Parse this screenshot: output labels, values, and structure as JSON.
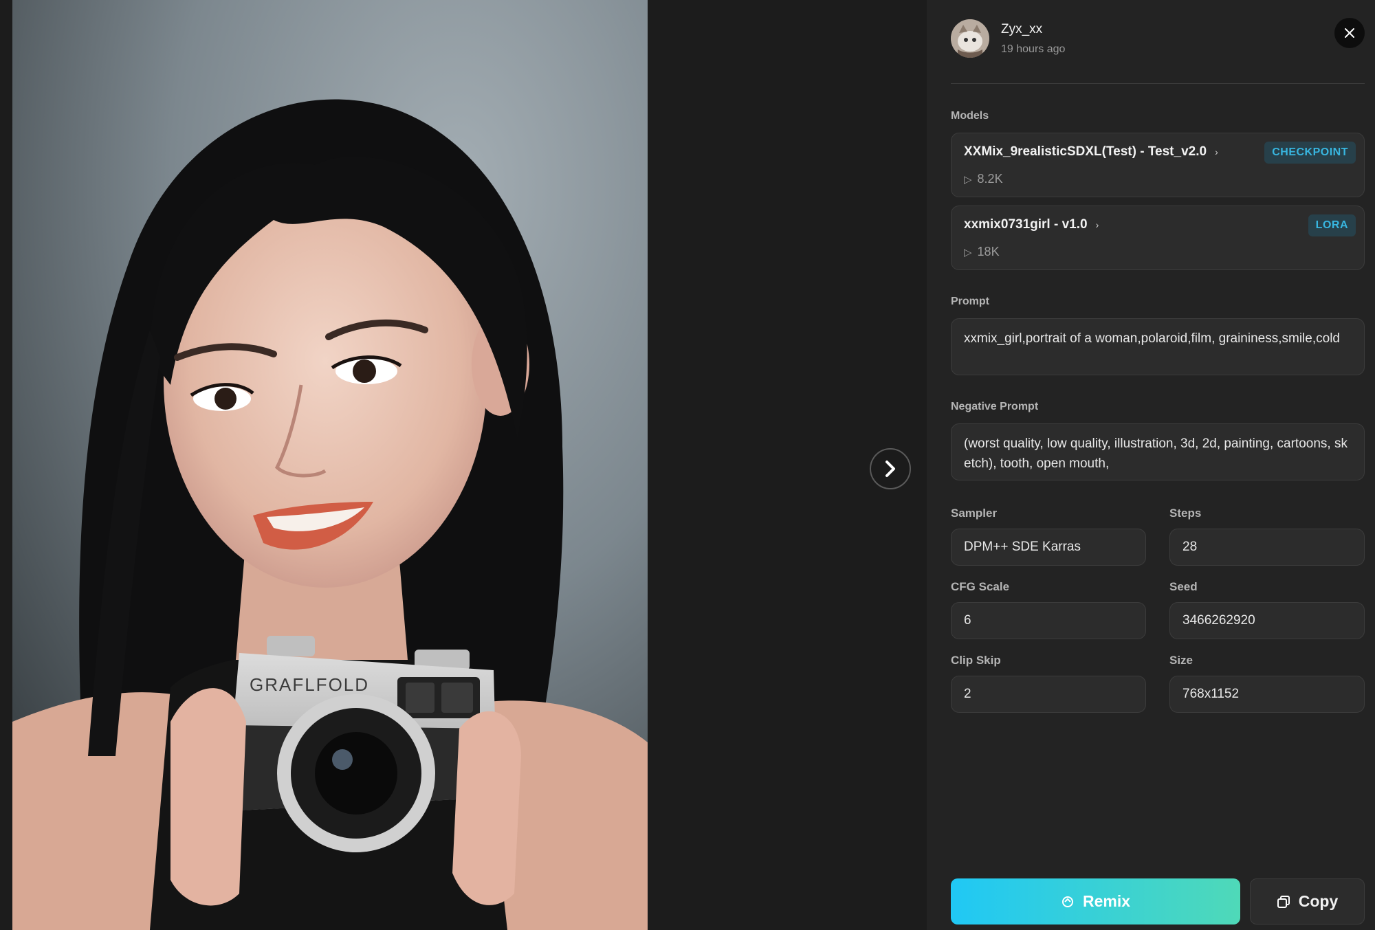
{
  "author": {
    "name": "Zyx_xx",
    "time": "19 hours ago"
  },
  "sections": {
    "models": "Models",
    "prompt": "Prompt",
    "negative_prompt": "Negative Prompt"
  },
  "models": [
    {
      "title": "XXMix_9realisticSDXL(Test) - Test_v2.0",
      "uses": "8.2K",
      "badge": "CHECKPOINT"
    },
    {
      "title": "xxmix0731girl - v1.0",
      "uses": "18K",
      "badge": "LORA"
    }
  ],
  "prompt": "xxmix_girl,portrait of a woman,polaroid,film, graininess,smile,cold",
  "negative_prompt": "(worst quality, low quality, illustration, 3d, 2d, painting, cartoons, sketch), tooth, open mouth,",
  "params": {
    "sampler": {
      "label": "Sampler",
      "value": "DPM++ SDE Karras"
    },
    "steps": {
      "label": "Steps",
      "value": "28"
    },
    "cfg": {
      "label": "CFG Scale",
      "value": "6"
    },
    "seed": {
      "label": "Seed",
      "value": "3466262920"
    },
    "clip_skip": {
      "label": "Clip Skip",
      "value": "2"
    },
    "size": {
      "label": "Size",
      "value": "768x1152"
    }
  },
  "actions": {
    "remix": "Remix",
    "copy": "Copy"
  },
  "photo": {
    "camera_brand": "GRAFLFOLD"
  },
  "colors": {
    "accent_start": "#20c8f5",
    "accent_end": "#4fd9b8",
    "badge_text": "#38b6e0",
    "panel_bg": "#232323"
  },
  "icons": {
    "next": "chevron-right-icon",
    "close": "close-icon",
    "remix": "remix-icon",
    "copy": "copy-icon",
    "play": "play-icon"
  }
}
